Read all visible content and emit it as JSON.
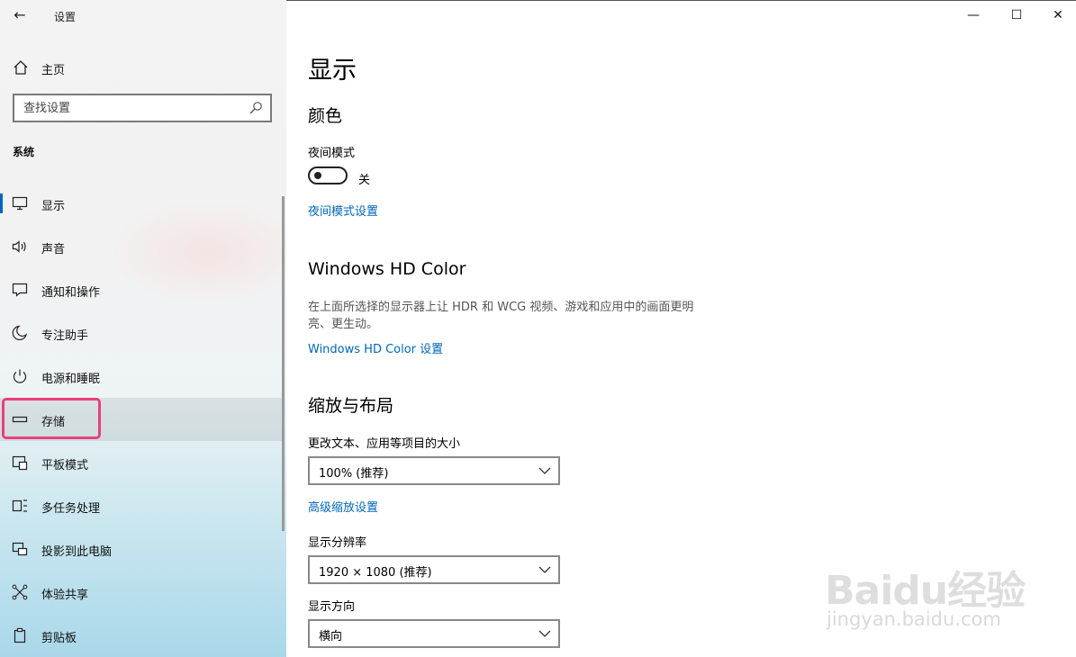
{
  "window": {
    "title": "设置",
    "minimize_glyph": "—",
    "maximize_glyph": "☐",
    "close_glyph": "✕",
    "back_glyph": "←"
  },
  "sidebar": {
    "home_label": "主页",
    "search_placeholder": "查找设置",
    "section_label": "系统",
    "items": [
      {
        "label": "显示",
        "icon": "monitor-icon"
      },
      {
        "label": "声音",
        "icon": "speaker-icon"
      },
      {
        "label": "通知和操作",
        "icon": "notification-icon"
      },
      {
        "label": "专注助手",
        "icon": "moon-icon"
      },
      {
        "label": "电源和睡眠",
        "icon": "power-icon"
      },
      {
        "label": "存储",
        "icon": "storage-icon"
      },
      {
        "label": "平板模式",
        "icon": "tablet-icon"
      },
      {
        "label": "多任务处理",
        "icon": "multitask-icon"
      },
      {
        "label": "投影到此电脑",
        "icon": "project-icon"
      },
      {
        "label": "体验共享",
        "icon": "share-icon"
      },
      {
        "label": "剪贴板",
        "icon": "clipboard-icon"
      }
    ]
  },
  "main": {
    "page_title": "显示",
    "color_section": {
      "heading": "颜色",
      "night_mode_label": "夜间模式",
      "night_mode_state": "关",
      "night_mode_link": "夜间模式设置"
    },
    "hdr_section": {
      "heading": "Windows HD Color",
      "description": "在上面所选择的显示器上让 HDR 和 WCG 视频、游戏和应用中的画面更明亮、更生动。",
      "link": "Windows HD Color 设置"
    },
    "scale_section": {
      "heading": "缩放与布局",
      "text_size_label": "更改文本、应用等项目的大小",
      "text_size_value": "100% (推荐)",
      "advanced_link": "高级缩放设置",
      "resolution_label": "显示分辨率",
      "resolution_value": "1920 × 1080 (推荐)",
      "orientation_label": "显示方向",
      "orientation_value": "横向"
    }
  },
  "watermark": {
    "logo": "Baidu经验",
    "sub": "jingyan.baidu.com"
  }
}
